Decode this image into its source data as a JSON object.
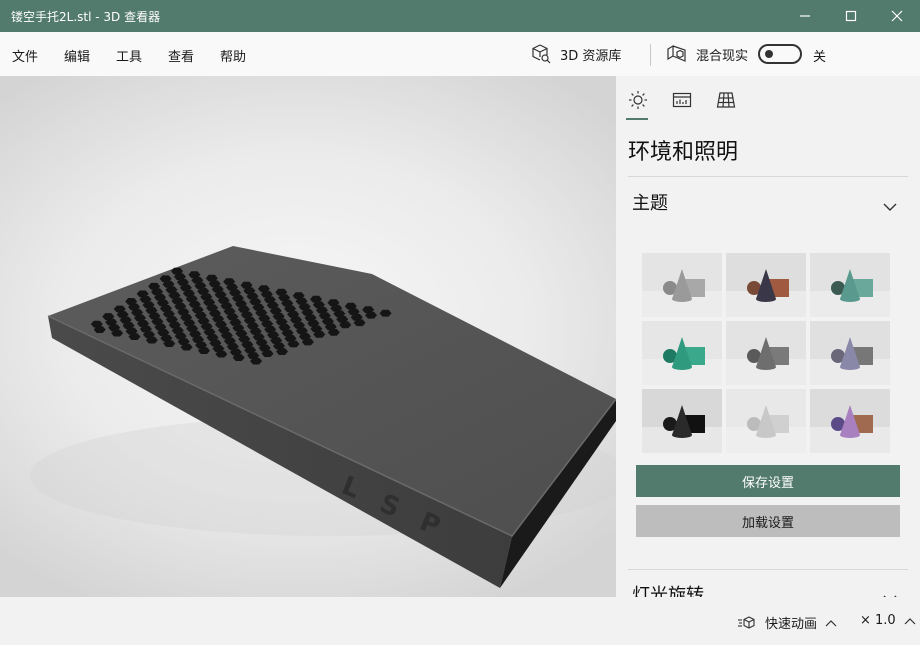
{
  "window": {
    "title": "镂空手托2L.stl - 3D 查看器"
  },
  "menu": {
    "items": [
      "文件",
      "编辑",
      "工具",
      "查看",
      "帮助"
    ],
    "library_label": "3D 资源库",
    "mixed_reality_label": "混合现实",
    "mixed_reality_state": "关"
  },
  "panel": {
    "title": "环境和照明",
    "theme_section": "主题",
    "themes": [
      {
        "bg": "#e4e4e4",
        "cone": "#9a9a9a",
        "sphere": "#8a8a8a",
        "cube": "#a8a8a8"
      },
      {
        "bg": "#dedede",
        "cone": "#3a3848",
        "sphere": "#7a4a38",
        "cube": "#a05a40"
      },
      {
        "bg": "#e2e2e2",
        "cone": "#5a9a8e",
        "sphere": "#3a5a52",
        "cube": "#6aa89c"
      },
      {
        "bg": "#e6e6e6",
        "cone": "#2f9a7e",
        "sphere": "#1e7a62",
        "cube": "#3aa88a"
      },
      {
        "bg": "#e3e3e3",
        "cone": "#6e6e6e",
        "sphere": "#5a5a5a",
        "cube": "#7a7a7a"
      },
      {
        "bg": "#e0e0e0",
        "cone": "#8a88a8",
        "sphere": "#6a6878",
        "cube": "#777777"
      },
      {
        "bg": "#d8d8d8",
        "cone": "#2a2a2a",
        "sphere": "#1a1a1a",
        "cube": "#111111"
      },
      {
        "bg": "#e8e8e8",
        "cone": "#c8c8c8",
        "sphere": "#bcbcbc",
        "cube": "#d0d0d0"
      },
      {
        "bg": "#dcdcdc",
        "cone": "#a880c0",
        "sphere": "#5a4a88",
        "cube": "#a06a50"
      }
    ],
    "save_label": "保存设置",
    "load_label": "加载设置",
    "light_section": "灯光旋转"
  },
  "model": {
    "engraving": [
      "L",
      "S",
      "P"
    ]
  },
  "status": {
    "animation_label": "快速动画",
    "speed_value": "× 1.0"
  },
  "colors": {
    "accent": "#527a6d",
    "secondary_button": "#bdbdbd"
  }
}
